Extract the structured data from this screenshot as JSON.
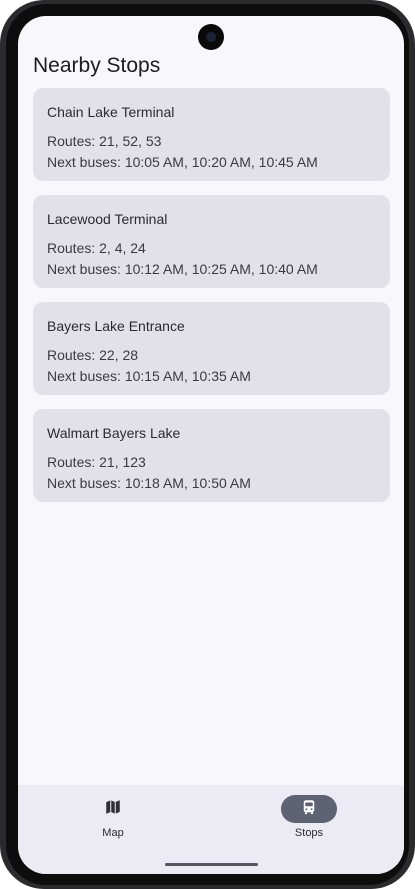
{
  "page": {
    "title": "Nearby Stops"
  },
  "stops": [
    {
      "name": "Chain Lake Terminal",
      "routes": "Routes: 21, 52, 53",
      "next": "Next buses: 10:05 AM, 10:20 AM, 10:45 AM"
    },
    {
      "name": "Lacewood Terminal",
      "routes": "Routes: 2, 4, 24",
      "next": "Next buses: 10:12 AM, 10:25 AM, 10:40 AM"
    },
    {
      "name": "Bayers Lake Entrance",
      "routes": "Routes: 22, 28",
      "next": "Next buses: 10:15 AM, 10:35 AM"
    },
    {
      "name": "Walmart Bayers Lake",
      "routes": "Routes: 21, 123",
      "next": "Next buses: 10:18 AM, 10:50 AM"
    }
  ],
  "nav": {
    "map_label": "Map",
    "map_icon": "map-icon",
    "stops_label": "Stops",
    "stops_icon": "bus-icon",
    "selected": "Stops"
  },
  "colors": {
    "background": "#f8f7fc",
    "card": "#e2e1ea",
    "nav_background": "#eceaf3",
    "active_pill": "#5f6273"
  }
}
